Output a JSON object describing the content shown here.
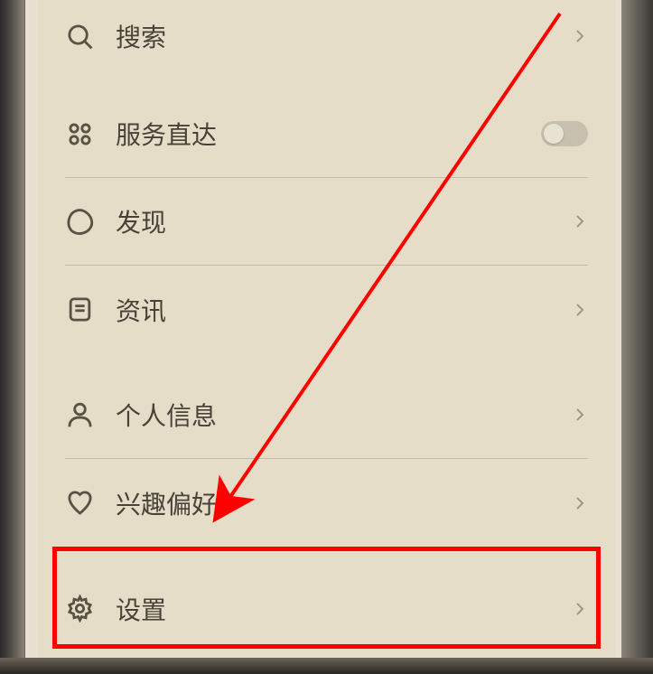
{
  "menu": {
    "search": {
      "label": "搜索"
    },
    "shortcuts": {
      "label": "服务直达"
    },
    "discover": {
      "label": "发现"
    },
    "news": {
      "label": "资讯"
    },
    "profile": {
      "label": "个人信息"
    },
    "interests": {
      "label": "兴趣偏好"
    },
    "settings": {
      "label": "设置"
    }
  }
}
